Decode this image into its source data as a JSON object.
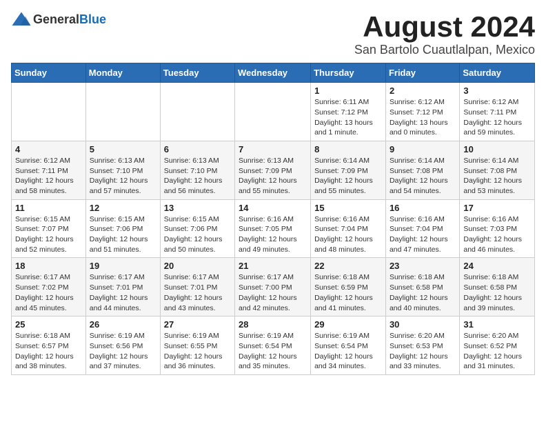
{
  "logo": {
    "general": "General",
    "blue": "Blue"
  },
  "title": "August 2024",
  "location": "San Bartolo Cuautlalpan, Mexico",
  "days_of_week": [
    "Sunday",
    "Monday",
    "Tuesday",
    "Wednesday",
    "Thursday",
    "Friday",
    "Saturday"
  ],
  "weeks": [
    [
      {
        "day": "",
        "info": ""
      },
      {
        "day": "",
        "info": ""
      },
      {
        "day": "",
        "info": ""
      },
      {
        "day": "",
        "info": ""
      },
      {
        "day": "1",
        "info": "Sunrise: 6:11 AM\nSunset: 7:12 PM\nDaylight: 13 hours\nand 1 minute."
      },
      {
        "day": "2",
        "info": "Sunrise: 6:12 AM\nSunset: 7:12 PM\nDaylight: 13 hours\nand 0 minutes."
      },
      {
        "day": "3",
        "info": "Sunrise: 6:12 AM\nSunset: 7:11 PM\nDaylight: 12 hours\nand 59 minutes."
      }
    ],
    [
      {
        "day": "4",
        "info": "Sunrise: 6:12 AM\nSunset: 7:11 PM\nDaylight: 12 hours\nand 58 minutes."
      },
      {
        "day": "5",
        "info": "Sunrise: 6:13 AM\nSunset: 7:10 PM\nDaylight: 12 hours\nand 57 minutes."
      },
      {
        "day": "6",
        "info": "Sunrise: 6:13 AM\nSunset: 7:10 PM\nDaylight: 12 hours\nand 56 minutes."
      },
      {
        "day": "7",
        "info": "Sunrise: 6:13 AM\nSunset: 7:09 PM\nDaylight: 12 hours\nand 55 minutes."
      },
      {
        "day": "8",
        "info": "Sunrise: 6:14 AM\nSunset: 7:09 PM\nDaylight: 12 hours\nand 55 minutes."
      },
      {
        "day": "9",
        "info": "Sunrise: 6:14 AM\nSunset: 7:08 PM\nDaylight: 12 hours\nand 54 minutes."
      },
      {
        "day": "10",
        "info": "Sunrise: 6:14 AM\nSunset: 7:08 PM\nDaylight: 12 hours\nand 53 minutes."
      }
    ],
    [
      {
        "day": "11",
        "info": "Sunrise: 6:15 AM\nSunset: 7:07 PM\nDaylight: 12 hours\nand 52 minutes."
      },
      {
        "day": "12",
        "info": "Sunrise: 6:15 AM\nSunset: 7:06 PM\nDaylight: 12 hours\nand 51 minutes."
      },
      {
        "day": "13",
        "info": "Sunrise: 6:15 AM\nSunset: 7:06 PM\nDaylight: 12 hours\nand 50 minutes."
      },
      {
        "day": "14",
        "info": "Sunrise: 6:16 AM\nSunset: 7:05 PM\nDaylight: 12 hours\nand 49 minutes."
      },
      {
        "day": "15",
        "info": "Sunrise: 6:16 AM\nSunset: 7:04 PM\nDaylight: 12 hours\nand 48 minutes."
      },
      {
        "day": "16",
        "info": "Sunrise: 6:16 AM\nSunset: 7:04 PM\nDaylight: 12 hours\nand 47 minutes."
      },
      {
        "day": "17",
        "info": "Sunrise: 6:16 AM\nSunset: 7:03 PM\nDaylight: 12 hours\nand 46 minutes."
      }
    ],
    [
      {
        "day": "18",
        "info": "Sunrise: 6:17 AM\nSunset: 7:02 PM\nDaylight: 12 hours\nand 45 minutes."
      },
      {
        "day": "19",
        "info": "Sunrise: 6:17 AM\nSunset: 7:01 PM\nDaylight: 12 hours\nand 44 minutes."
      },
      {
        "day": "20",
        "info": "Sunrise: 6:17 AM\nSunset: 7:01 PM\nDaylight: 12 hours\nand 43 minutes."
      },
      {
        "day": "21",
        "info": "Sunrise: 6:17 AM\nSunset: 7:00 PM\nDaylight: 12 hours\nand 42 minutes."
      },
      {
        "day": "22",
        "info": "Sunrise: 6:18 AM\nSunset: 6:59 PM\nDaylight: 12 hours\nand 41 minutes."
      },
      {
        "day": "23",
        "info": "Sunrise: 6:18 AM\nSunset: 6:58 PM\nDaylight: 12 hours\nand 40 minutes."
      },
      {
        "day": "24",
        "info": "Sunrise: 6:18 AM\nSunset: 6:58 PM\nDaylight: 12 hours\nand 39 minutes."
      }
    ],
    [
      {
        "day": "25",
        "info": "Sunrise: 6:18 AM\nSunset: 6:57 PM\nDaylight: 12 hours\nand 38 minutes."
      },
      {
        "day": "26",
        "info": "Sunrise: 6:19 AM\nSunset: 6:56 PM\nDaylight: 12 hours\nand 37 minutes."
      },
      {
        "day": "27",
        "info": "Sunrise: 6:19 AM\nSunset: 6:55 PM\nDaylight: 12 hours\nand 36 minutes."
      },
      {
        "day": "28",
        "info": "Sunrise: 6:19 AM\nSunset: 6:54 PM\nDaylight: 12 hours\nand 35 minutes."
      },
      {
        "day": "29",
        "info": "Sunrise: 6:19 AM\nSunset: 6:54 PM\nDaylight: 12 hours\nand 34 minutes."
      },
      {
        "day": "30",
        "info": "Sunrise: 6:20 AM\nSunset: 6:53 PM\nDaylight: 12 hours\nand 33 minutes."
      },
      {
        "day": "31",
        "info": "Sunrise: 6:20 AM\nSunset: 6:52 PM\nDaylight: 12 hours\nand 31 minutes."
      }
    ]
  ]
}
